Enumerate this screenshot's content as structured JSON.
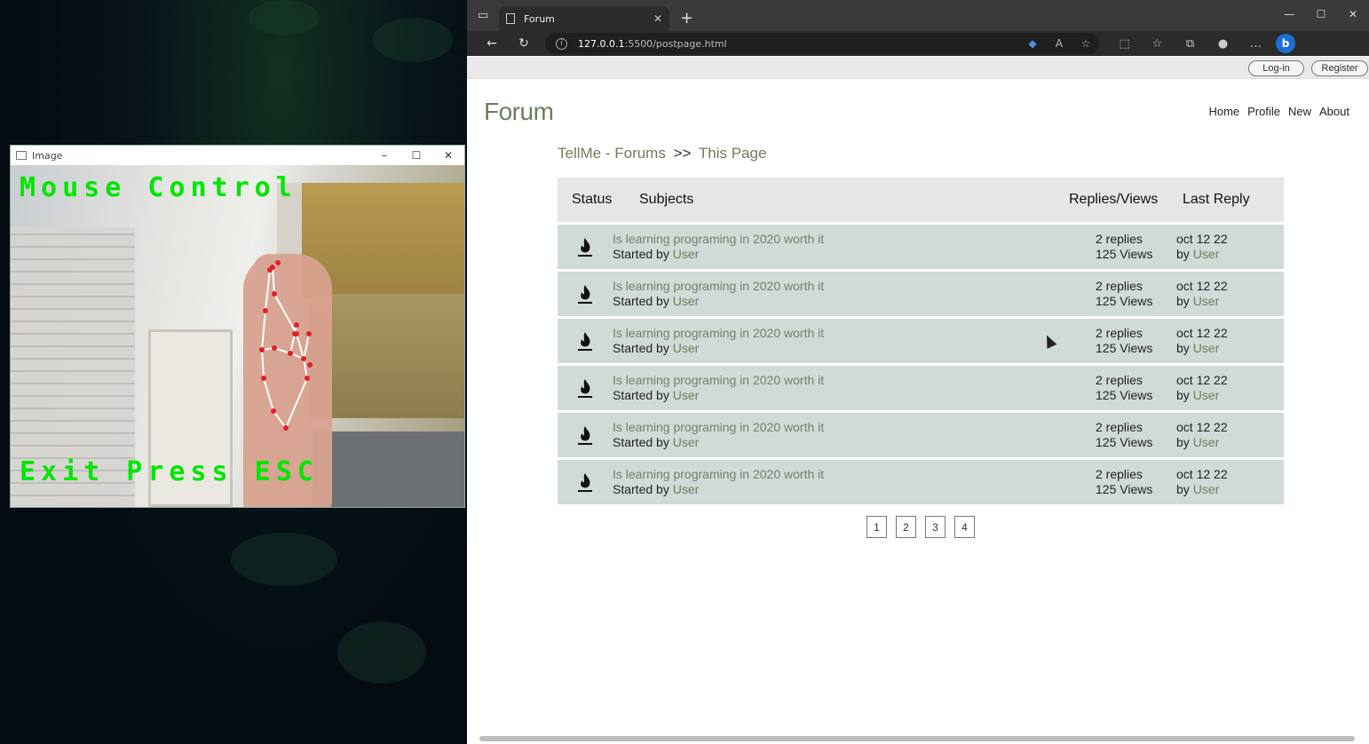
{
  "camera_window": {
    "title": "Image",
    "overlay_top": "Mouse Control",
    "overlay_bottom": "Exit Press ESC",
    "controls": [
      "–",
      "☐",
      "✕"
    ]
  },
  "browser": {
    "tab_title": "Forum",
    "url_host": "127.0.0.1",
    "url_path": ":5500/postpage.html"
  },
  "site": {
    "login_label": "Log-in",
    "register_label": "Register",
    "title": "Forum",
    "nav": [
      "Home",
      "Profile",
      "New",
      "About"
    ],
    "breadcrumb": {
      "part1": "TellMe - Forums",
      "sep": ">>",
      "part2": "This Page"
    },
    "table": {
      "headers": {
        "status": "Status",
        "subjects": "Subjects",
        "replies_views": "Replies/Views",
        "last_reply": "Last Reply"
      },
      "rows": [
        {
          "subject": "Is learning programing in 2020 worth it",
          "started_by": "Started by",
          "user": "User",
          "replies": "2 replies",
          "views": "125 Views",
          "date": "oct 12 22",
          "by": "by",
          "last_user": "User"
        },
        {
          "subject": "Is learning programing in 2020 worth it",
          "started_by": "Started by",
          "user": "User",
          "replies": "2 replies",
          "views": "125 Views",
          "date": "oct 12 22",
          "by": "by",
          "last_user": "User"
        },
        {
          "subject": "Is learning programing in 2020 worth it",
          "started_by": "Started by",
          "user": "User",
          "replies": "2 replies",
          "views": "125 Views",
          "date": "oct 12 22",
          "by": "by",
          "last_user": "User"
        },
        {
          "subject": "Is learning programing in 2020 worth it",
          "started_by": "Started by",
          "user": "User",
          "replies": "2 replies",
          "views": "125 Views",
          "date": "oct 12 22",
          "by": "by",
          "last_user": "User"
        },
        {
          "subject": "Is learning programing in 2020 worth it",
          "started_by": "Started by",
          "user": "User",
          "replies": "2 replies",
          "views": "125 Views",
          "date": "oct 12 22",
          "by": "by",
          "last_user": "User"
        },
        {
          "subject": "Is learning programing in 2020 worth it",
          "started_by": "Started by",
          "user": "User",
          "replies": "2 replies",
          "views": "125 Views",
          "date": "oct 12 22",
          "by": "by",
          "last_user": "User"
        }
      ]
    },
    "pages": [
      "1",
      "2",
      "3",
      "4"
    ]
  },
  "colors": {
    "accent": "#6f7d5e",
    "row_bg": "#d0dad6",
    "header_bg": "#e4e6e7",
    "overlay_green": "#00e600"
  }
}
